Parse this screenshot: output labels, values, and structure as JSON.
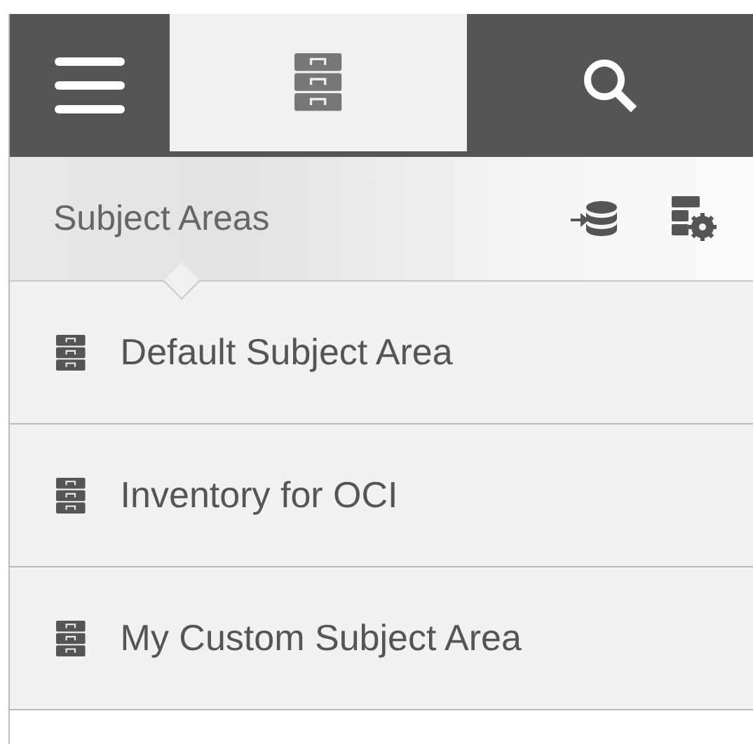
{
  "toolbar": {
    "tabs": [
      {
        "kind": "menu",
        "selected": false
      },
      {
        "kind": "subject-areas",
        "selected": true
      },
      {
        "kind": "search",
        "selected": false
      }
    ]
  },
  "panel": {
    "title": "Subject Areas",
    "actions": [
      {
        "kind": "import"
      },
      {
        "kind": "settings"
      }
    ]
  },
  "subject_areas": [
    {
      "label": "Default Subject Area"
    },
    {
      "label": "Inventory for OCI"
    },
    {
      "label": "My Custom Subject Area"
    }
  ]
}
